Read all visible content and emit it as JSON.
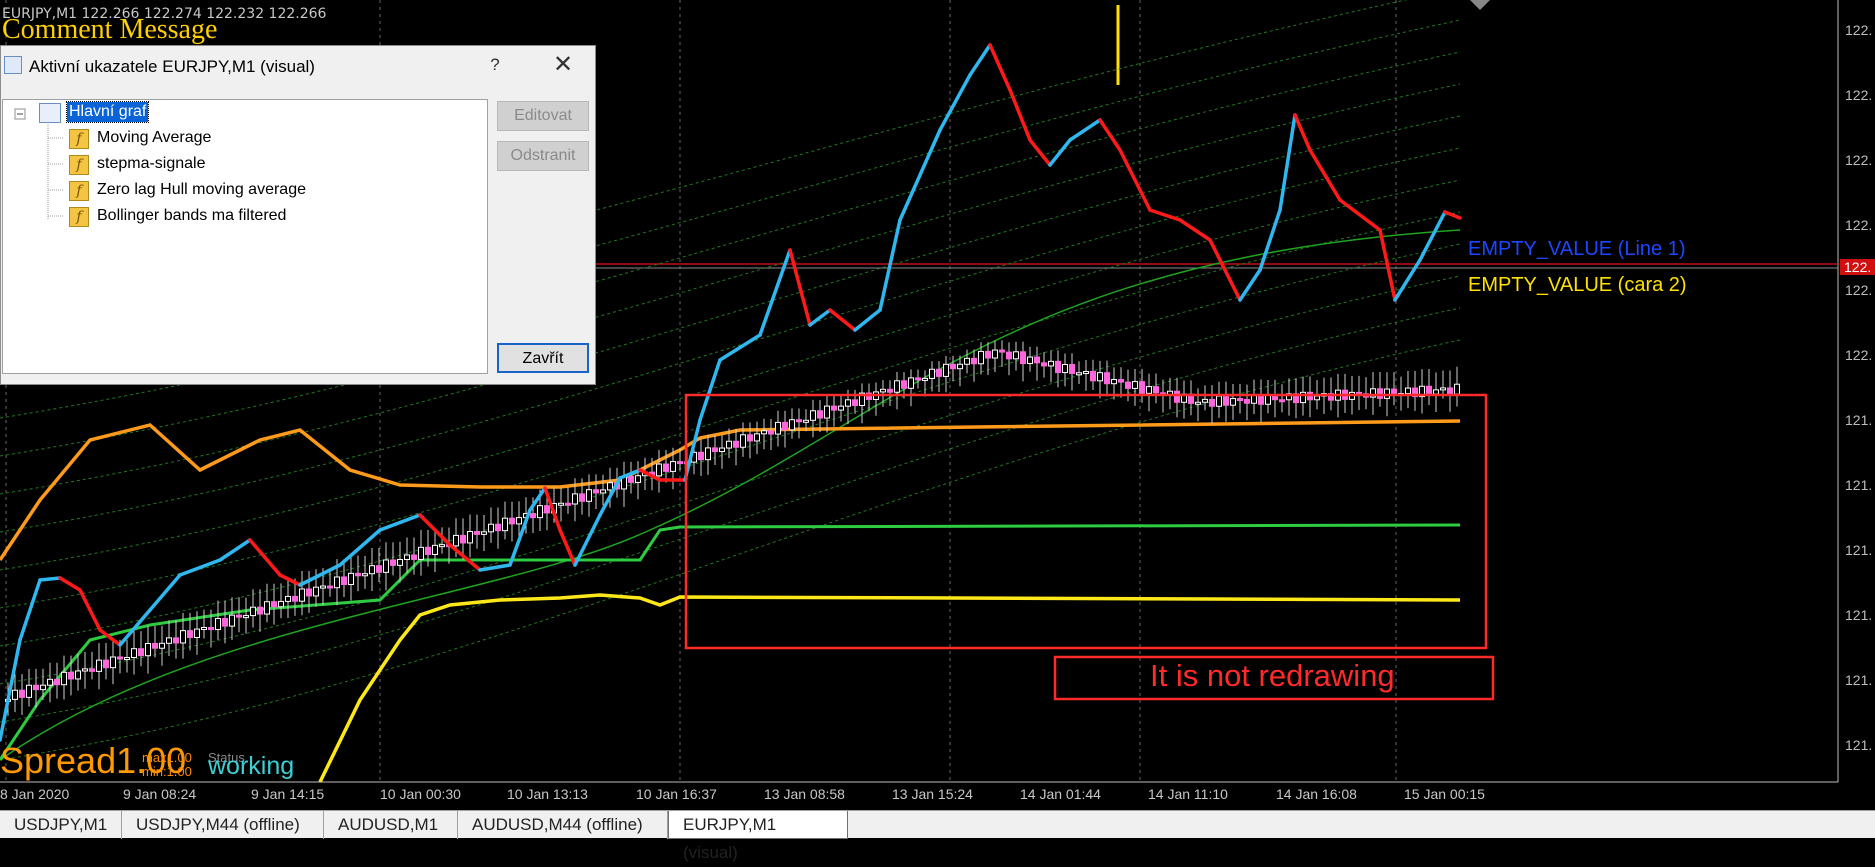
{
  "chart": {
    "quote_line": "EURJPY,M1  122.266 122.274 122.232 122.266",
    "comment": "Comment Message",
    "empty_value_1": "EMPTY_VALUE (Line 1)",
    "empty_value_2": "EMPTY_VALUE (cara 2)",
    "annotation": "It is not redrawing",
    "spread_text": "Spread1.00",
    "spread_max": "max1.00",
    "spread_min": "min:1.00",
    "status_label": "Status",
    "status_value": "working",
    "time_labels": [
      "8 Jan 2020",
      "9 Jan 08:24",
      "9 Jan 14:15",
      "10 Jan 00:30",
      "10 Jan 13:13",
      "10 Jan 16:37",
      "13 Jan 08:58",
      "13 Jan 15:24",
      "14 Jan 01:44",
      "14 Jan 11:10",
      "14 Jan 16:08",
      "15 Jan 00:15"
    ],
    "price_labels": [
      "122.",
      "122.",
      "122.",
      "122.",
      "122.",
      "122.",
      "122.",
      "121.",
      "121.",
      "121.",
      "121.",
      "121.",
      "121."
    ],
    "current_price_label": "122.",
    "colors": {
      "background": "#000000",
      "hull_up": "#2fb7f0",
      "hull_down": "#ff1a1a",
      "band_upper": "#ff9a1a",
      "band_middle": "#2ecc40",
      "band_lower": "#ffe81a",
      "candle_bull": "#ffffff",
      "candle_bear": "#ff66dd",
      "annotation": "#ff2a2a"
    }
  },
  "dialog": {
    "title": "Aktivní ukazatele EURJPY,M1 (visual)",
    "help": "?",
    "close": "✕",
    "tree_root": "Hlavní graf",
    "indicators": [
      "Moving Average",
      "stepma-signale",
      "Zero lag Hull moving average",
      "Bollinger bands ma filtered"
    ],
    "edit_button": "Editovat",
    "remove_button": "Odstranit",
    "close_button": "Zavřít"
  },
  "tabs": [
    {
      "label": "USDJPY,M1",
      "active": false
    },
    {
      "label": "USDJPY,M44 (offline)",
      "active": false
    },
    {
      "label": "AUDUSD,M1",
      "active": false
    },
    {
      "label": "AUDUSD,M44 (offline)",
      "active": false
    },
    {
      "label": "EURJPY,M1 (visual)",
      "active": true
    }
  ]
}
